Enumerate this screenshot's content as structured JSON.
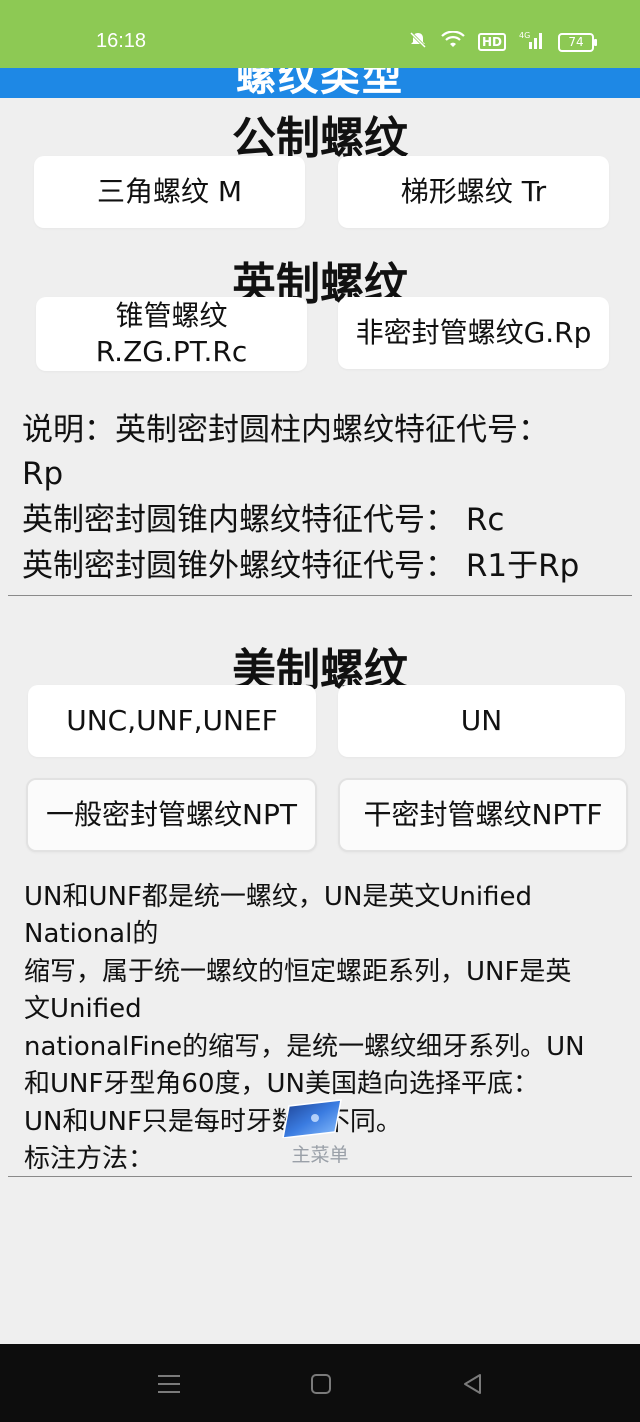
{
  "status_bar": {
    "time": "16:18",
    "battery": "74",
    "icons": [
      "mute-icon",
      "wifi-icon",
      "hd-icon",
      "4g-signal-icon",
      "battery-icon"
    ],
    "hd_label": "HD",
    "network_label": "4G",
    "color": "#8dc954"
  },
  "app": {
    "title": "螺纹类型",
    "accent": "#1e88e5"
  },
  "metric": {
    "heading": "公制螺纹",
    "buttons": [
      "三角螺纹 M",
      "梯形螺纹 Tr"
    ]
  },
  "imperial": {
    "heading": "英制螺纹",
    "buttons": [
      "锥管螺纹R.ZG.PT.Rc",
      "非密封管螺纹G.Rp"
    ],
    "button_lines": [
      "锥管螺纹",
      "R.ZG.PT.Rc"
    ],
    "note_lines": [
      "说明：英制密封圆柱内螺纹特征代号：",
      "Rp",
      "英制密封圆锥内螺纹特征代号：  Rc",
      "英制密封圆锥外螺纹特征代号：  R1于Rp"
    ]
  },
  "american": {
    "heading": "美制螺纹",
    "buttons": [
      "UNC,UNF,UNEF",
      "UN",
      "一般密封管螺纹NPT",
      "干密封管螺纹NPTF"
    ],
    "note_lines": [
      "UN和UNF都是统一螺纹，UN是英文Unified",
      "National的",
      "缩写，属于统一螺纹的恒定螺距系列，UNF是英",
      "文Unified",
      "nationalFine的缩写，是统一螺纹细牙系列。UN",
      "和UNF牙型角60度，UN美国趋向选择平底：",
      "UN和UNF只是每时牙数的不同。",
      "标注方法："
    ]
  },
  "bottom": {
    "menu_label": "主菜单",
    "menu_icon": "phone-icon"
  },
  "nav_bar": {
    "icons": [
      "menu-icon",
      "home-icon",
      "back-icon"
    ]
  }
}
